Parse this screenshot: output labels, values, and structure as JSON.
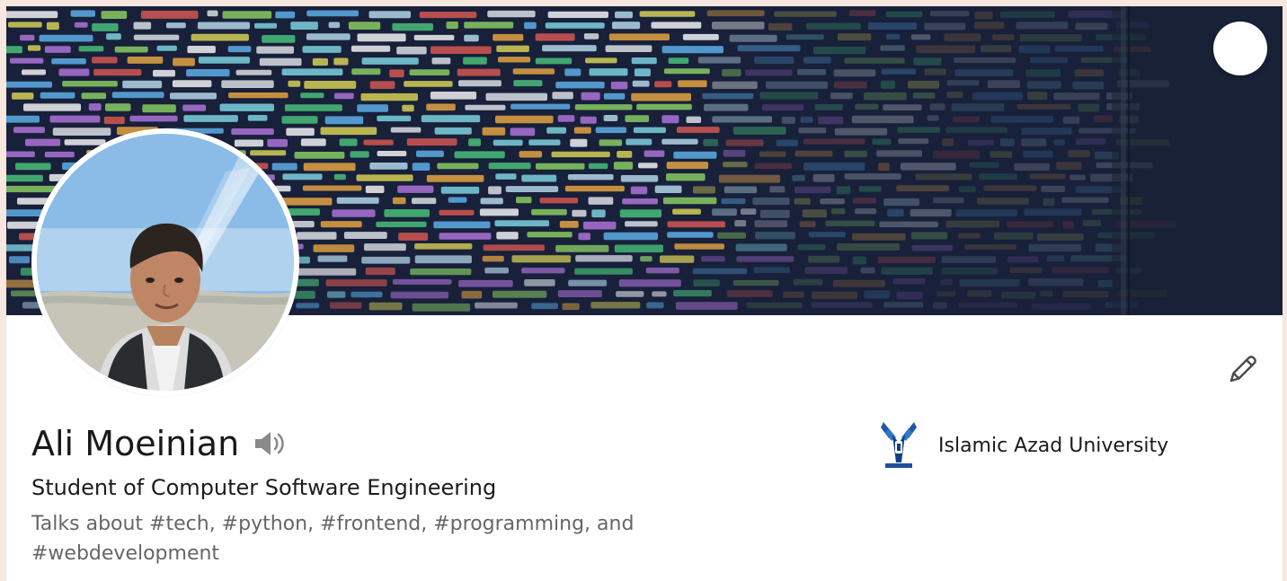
{
  "profile": {
    "name": "Ali Moeinian",
    "headline": "Student of Computer Software Engineering",
    "talks_about": "Talks about #tech, #python, #frontend, #programming, and #webdevelopment",
    "school": "Islamic Azad University"
  },
  "icons": {
    "banner_edit": "pencil-icon",
    "profile_edit": "pencil-icon",
    "pronunciation": "speaker-icon",
    "school_logo": "university-logo"
  },
  "colors": {
    "page_background": "#f8e7df",
    "card_background": "#ffffff",
    "name_text": "#191919",
    "secondary_text": "#666666",
    "accent_blue": "#0a66c2"
  }
}
